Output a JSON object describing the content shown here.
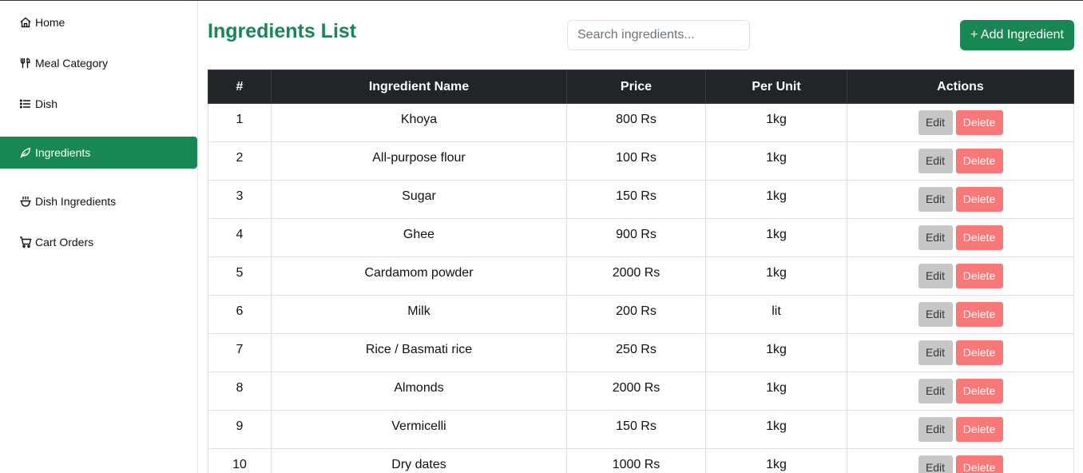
{
  "sidebar": {
    "items": [
      {
        "label": "Home",
        "icon": "home-icon"
      },
      {
        "label": "Meal Category",
        "icon": "utensils-icon"
      },
      {
        "label": "Dish",
        "icon": "list-icon"
      },
      {
        "label": "Ingredients",
        "icon": "leaf-icon",
        "active": true
      },
      {
        "label": "Dish Ingredients",
        "icon": "pot-icon"
      },
      {
        "label": "Cart Orders",
        "icon": "cart-icon"
      }
    ]
  },
  "header": {
    "title": "Ingredients List",
    "search_placeholder": "Search ingredients...",
    "search_value": "",
    "add_label": "+ Add Ingredient"
  },
  "table": {
    "columns": [
      "#",
      "Ingredient Name",
      "Price",
      "Per Unit",
      "Actions"
    ],
    "edit_label": "Edit",
    "delete_label": "Delete",
    "rows": [
      {
        "num": "1",
        "name": "Khoya",
        "price": "800 Rs",
        "unit": "1kg"
      },
      {
        "num": "2",
        "name": "All-purpose flour",
        "price": "100 Rs",
        "unit": "1kg"
      },
      {
        "num": "3",
        "name": "Sugar",
        "price": "150 Rs",
        "unit": "1kg"
      },
      {
        "num": "4",
        "name": "Ghee",
        "price": "900 Rs",
        "unit": "1kg"
      },
      {
        "num": "5",
        "name": "Cardamom powder",
        "price": "2000 Rs",
        "unit": "1kg"
      },
      {
        "num": "6",
        "name": "Milk",
        "price": "200 Rs",
        "unit": "lit"
      },
      {
        "num": "7",
        "name": "Rice / Basmati rice",
        "price": "250 Rs",
        "unit": "1kg"
      },
      {
        "num": "8",
        "name": "Almonds",
        "price": "2000 Rs",
        "unit": "1kg"
      },
      {
        "num": "9",
        "name": "Vermicelli",
        "price": "150 Rs",
        "unit": "1kg"
      },
      {
        "num": "10",
        "name": "Dry dates",
        "price": "1000 Rs",
        "unit": "1kg"
      }
    ]
  },
  "colors": {
    "accent": "#198754",
    "header_bg": "#212529",
    "delete": "#f8787a",
    "edit": "#c6c6c6"
  }
}
